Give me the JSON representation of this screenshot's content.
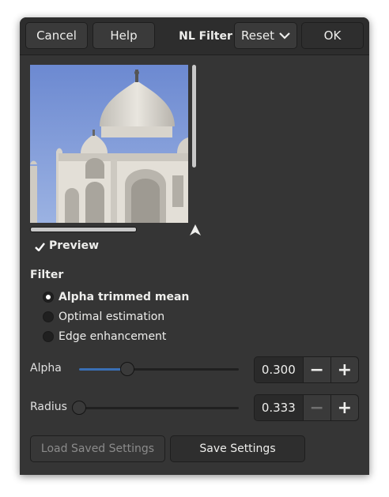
{
  "header": {
    "cancel_label": "Cancel",
    "help_label": "Help",
    "title": "NL Filter",
    "reset_label": "Reset",
    "ok_label": "OK"
  },
  "preview": {
    "label": "Preview",
    "checked": true
  },
  "filter": {
    "section_label": "Filter",
    "options": [
      {
        "label": "Alpha trimmed mean",
        "selected": true
      },
      {
        "label": "Optimal estimation",
        "selected": false
      },
      {
        "label": "Edge enhancement",
        "selected": false
      }
    ]
  },
  "alpha": {
    "label": "Alpha",
    "value": "0.300",
    "fraction": 0.3,
    "minus": "−",
    "plus": "+"
  },
  "radius": {
    "label": "Radius",
    "value": "0.333",
    "fraction": 0.0,
    "minus": "−",
    "plus": "+"
  },
  "footer": {
    "load_label": "Load Saved Settings",
    "save_label": "Save Settings"
  },
  "colors": {
    "dialog_bg": "#353535",
    "accent": "#3a6fb5"
  }
}
